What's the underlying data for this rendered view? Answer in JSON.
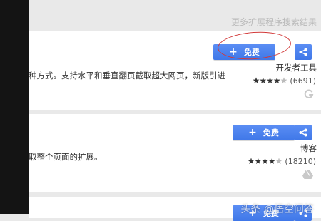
{
  "header": {
    "more_results": "更多扩展程序搜索结果"
  },
  "items": [
    {
      "description": "种方式。支持水平和垂直翻页截取超大网页，新版引进",
      "button_label": "免费",
      "category": "开发者工具",
      "rating_count": "(6691)",
      "source_icon": "google-g-icon"
    },
    {
      "description": "取整个页面的扩展。",
      "button_label": "免费",
      "category": "博客",
      "rating_count": "(18210)",
      "source_icon": "google-drive-icon"
    },
    {
      "button_label": "免费"
    }
  ],
  "watermark": "头条 @悟空问答",
  "colors": {
    "button_blue": "#4a80f0",
    "annotation_red": "#d23a3a"
  }
}
